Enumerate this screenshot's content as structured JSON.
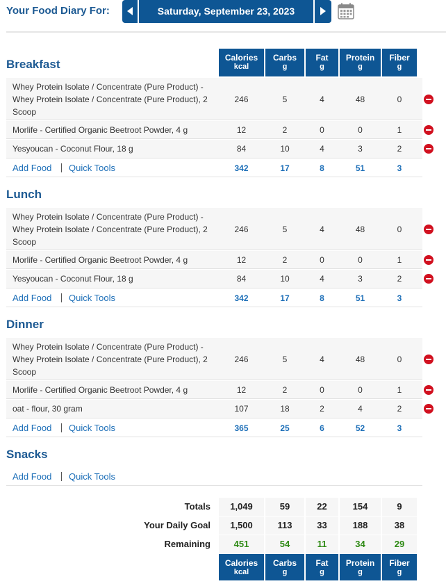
{
  "header": {
    "label": "Your Food Diary For:",
    "date": "Saturday, September 23, 2023",
    "prev_icon": "chevron-left-icon",
    "next_icon": "chevron-right-icon",
    "calendar_icon": "calendar-icon"
  },
  "columns": [
    {
      "label": "Calories",
      "unit": "kcal"
    },
    {
      "label": "Carbs",
      "unit": "g"
    },
    {
      "label": "Fat",
      "unit": "g"
    },
    {
      "label": "Protein",
      "unit": "g"
    },
    {
      "label": "Fiber",
      "unit": "g"
    }
  ],
  "meals": {
    "breakfast": {
      "title": "Breakfast",
      "items": [
        {
          "line1": "Whey Protein Isolate / Concentrate (Pure Product) -",
          "line2": "Whey Protein Isolate / Concentrate (Pure Product), 2",
          "line3": "Scoop",
          "calories": "246",
          "carbs": "5",
          "fat": "4",
          "protein": "48",
          "fiber": "0"
        },
        {
          "line1": "Morlife - Certified Organic Beetroot Powder, 4 g",
          "calories": "12",
          "carbs": "2",
          "fat": "0",
          "protein": "0",
          "fiber": "1"
        },
        {
          "line1": "Yesyoucan - Coconut Flour, 18 g",
          "calories": "84",
          "carbs": "10",
          "fat": "4",
          "protein": "3",
          "fiber": "2"
        }
      ],
      "totals": {
        "calories": "342",
        "carbs": "17",
        "fat": "8",
        "protein": "51",
        "fiber": "3"
      }
    },
    "lunch": {
      "title": "Lunch",
      "items": [
        {
          "line1": "Whey Protein Isolate / Concentrate (Pure Product) -",
          "line2": "Whey Protein Isolate / Concentrate (Pure Product), 2",
          "line3": "Scoop",
          "calories": "246",
          "carbs": "5",
          "fat": "4",
          "protein": "48",
          "fiber": "0"
        },
        {
          "line1": "Morlife - Certified Organic Beetroot Powder, 4 g",
          "calories": "12",
          "carbs": "2",
          "fat": "0",
          "protein": "0",
          "fiber": "1"
        },
        {
          "line1": "Yesyoucan - Coconut Flour, 18 g",
          "calories": "84",
          "carbs": "10",
          "fat": "4",
          "protein": "3",
          "fiber": "2"
        }
      ],
      "totals": {
        "calories": "342",
        "carbs": "17",
        "fat": "8",
        "protein": "51",
        "fiber": "3"
      }
    },
    "dinner": {
      "title": "Dinner",
      "items": [
        {
          "line1": "Whey Protein Isolate / Concentrate (Pure Product) -",
          "line2": "Whey Protein Isolate / Concentrate (Pure Product), 2",
          "line3": "Scoop",
          "calories": "246",
          "carbs": "5",
          "fat": "4",
          "protein": "48",
          "fiber": "0"
        },
        {
          "line1": "Morlife - Certified Organic Beetroot Powder, 4 g",
          "calories": "12",
          "carbs": "2",
          "fat": "0",
          "protein": "0",
          "fiber": "1"
        },
        {
          "line1": "oat - flour, 30 gram",
          "calories": "107",
          "carbs": "18",
          "fat": "2",
          "protein": "4",
          "fiber": "2"
        }
      ],
      "totals": {
        "calories": "365",
        "carbs": "25",
        "fat": "6",
        "protein": "52",
        "fiber": "3"
      }
    },
    "snacks": {
      "title": "Snacks"
    }
  },
  "actions": {
    "add_food": "Add Food",
    "quick_tools": "Quick Tools",
    "delete_icon": "remove-entry-icon"
  },
  "summary": {
    "totals": {
      "label": "Totals",
      "calories": "1,049",
      "carbs": "59",
      "fat": "22",
      "protein": "154",
      "fiber": "9"
    },
    "goal": {
      "label": "Your Daily Goal",
      "calories": "1,500",
      "carbs": "113",
      "fat": "33",
      "protein": "188",
      "fiber": "38"
    },
    "remaining": {
      "label": "Remaining",
      "calories": "451",
      "carbs": "54",
      "fat": "11",
      "protein": "34",
      "fiber": "29"
    }
  },
  "colors": {
    "header_blue": "#0e5694",
    "title_blue": "#1d5a93",
    "link_blue": "#1d6fb8",
    "remaining_green": "#2e8a14",
    "delete_red": "#d1101f"
  }
}
